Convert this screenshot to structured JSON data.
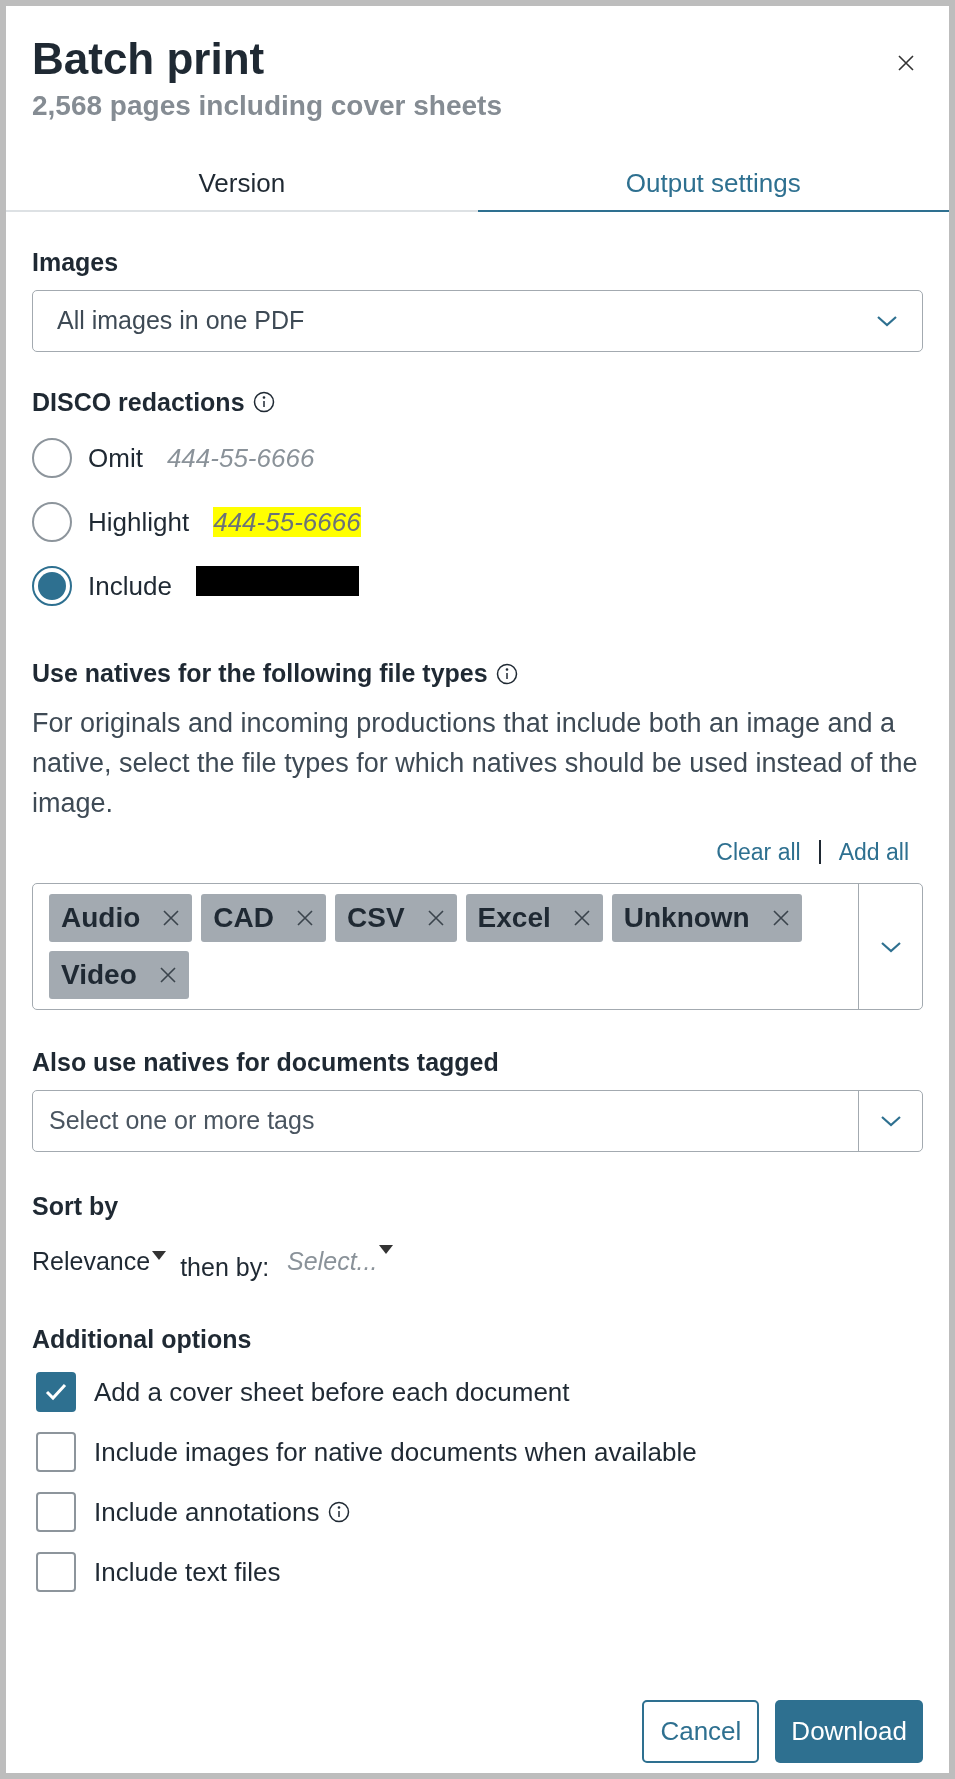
{
  "dialog": {
    "title": "Batch print",
    "subtitle": "2,568 pages including cover sheets"
  },
  "tabs": [
    {
      "label": "Version",
      "selected": false
    },
    {
      "label": "Output settings",
      "selected": true
    }
  ],
  "images": {
    "label": "Images",
    "value": "All images in one PDF"
  },
  "redactions": {
    "label": "DISCO redactions",
    "options": [
      {
        "label": "Omit",
        "sample": "444-55-6666",
        "kind": "omit",
        "selected": false
      },
      {
        "label": "Highlight",
        "sample": "444-55-6666",
        "kind": "highlight",
        "selected": false
      },
      {
        "label": "Include",
        "kind": "redacted",
        "selected": true
      }
    ]
  },
  "natives": {
    "label": "Use natives for the following file types",
    "description": "For originals and incoming productions that include both an image and a native, select the file types for which natives should be used instead of the image.",
    "links": [
      "Clear all",
      "Add all"
    ],
    "tags": [
      "Audio",
      "CAD",
      "CSV",
      "Excel",
      "Unknown",
      "Video"
    ]
  },
  "tagged": {
    "label": "Also use natives for documents tagged",
    "placeholder": "Select one or more tags"
  },
  "sort": {
    "label": "Sort by",
    "primary": "Relevance",
    "then_label": "then by:",
    "secondary_placeholder": "Select..."
  },
  "additional": {
    "label": "Additional options",
    "options": [
      {
        "label": "Add a cover sheet before each document",
        "checked": true,
        "info": false
      },
      {
        "label": "Include images for native documents when available",
        "checked": false,
        "info": false
      },
      {
        "label": "Include annotations",
        "checked": false,
        "info": true
      },
      {
        "label": "Include text files",
        "checked": false,
        "info": false
      }
    ]
  },
  "buttons": [
    {
      "label": "Cancel",
      "kind": "secondary"
    },
    {
      "label": "Download",
      "kind": "primary"
    }
  ]
}
